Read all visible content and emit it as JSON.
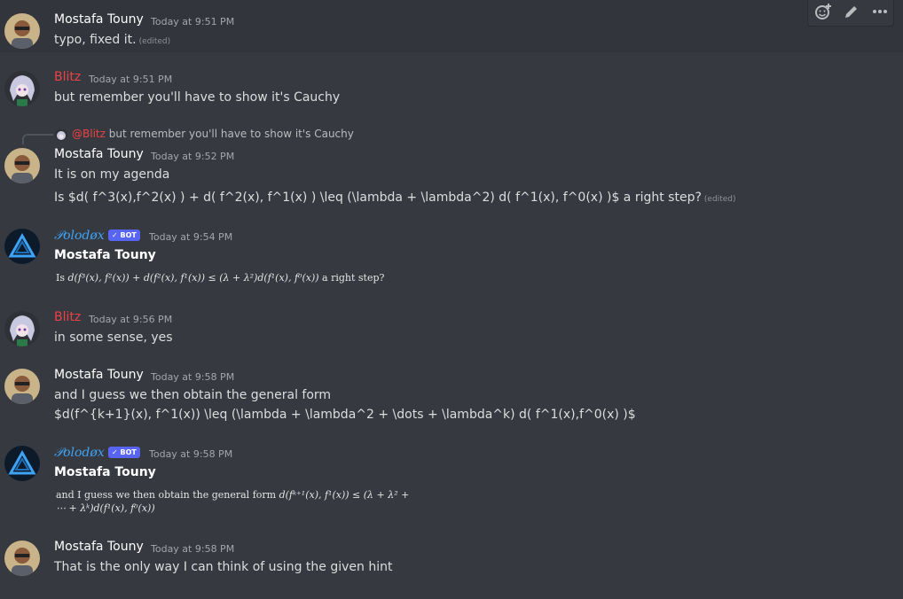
{
  "toolbar": {
    "icons": [
      "add-reaction-icon",
      "edit-icon",
      "more-icon"
    ]
  },
  "messages": [
    {
      "author": "Mostafa Touny",
      "timestamp": "Today at 9:51 PM",
      "lines": [
        "typo, fixed it."
      ],
      "edited": "(edited)"
    },
    {
      "author": "Blitz",
      "timestamp": "Today at 9:51 PM",
      "lines": [
        "but remember you'll have to show it's Cauchy"
      ]
    },
    {
      "reply": {
        "mention": "@Blitz",
        "text": "but remember you'll have to show it's Cauchy"
      },
      "author": "Mostafa Touny",
      "timestamp": "Today at 9:52 PM",
      "lines": [
        "It is on my agenda",
        "Is $d( f^3(x),f^2(x) ) + d( f^2(x), f^1(x) ) \\leq (\\lambda + \\lambda^2) d( f^1(x), f^0(x) )$ a right step?"
      ],
      "edited": "(edited)"
    },
    {
      "author": "𝒫olodøx",
      "badge": "✓ BOT",
      "timestamp": "Today at 9:54 PM",
      "title": "Mostafa Touny",
      "latex": {
        "prefix": "Is",
        "formula": "d(f³(x), f²(x)) + d(f²(x), f¹(x)) ≤ (λ + λ²)d(f¹(x), f⁰(x))",
        "suffix": "a right step?"
      }
    },
    {
      "author": "Blitz",
      "timestamp": "Today at 9:56 PM",
      "lines": [
        "in some sense, yes"
      ]
    },
    {
      "author": "Mostafa Touny",
      "timestamp": "Today at 9:58 PM",
      "lines": [
        "and I guess we then obtain the general form",
        "$d(f^{k+1}(x), f^1(x)) \\leq (\\lambda + \\lambda^2 + \\dots + \\lambda^k) d( f^1(x),f^0(x) )$"
      ]
    },
    {
      "author": "𝒫olodøx",
      "badge": "✓ BOT",
      "timestamp": "Today at 9:58 PM",
      "title": "Mostafa Touny",
      "latex": {
        "prefix": "and I guess we then obtain the general form",
        "formula1": "d(fᵏ⁺¹(x), f¹(x)) ≤ (λ + λ² +",
        "formula2": "⋯ + λᵏ)d(f¹(x), f⁰(x))"
      }
    },
    {
      "author": "Mostafa Touny",
      "timestamp": "Today at 9:58 PM",
      "lines": [
        "That is the only way I can think of using the given hint"
      ]
    }
  ]
}
